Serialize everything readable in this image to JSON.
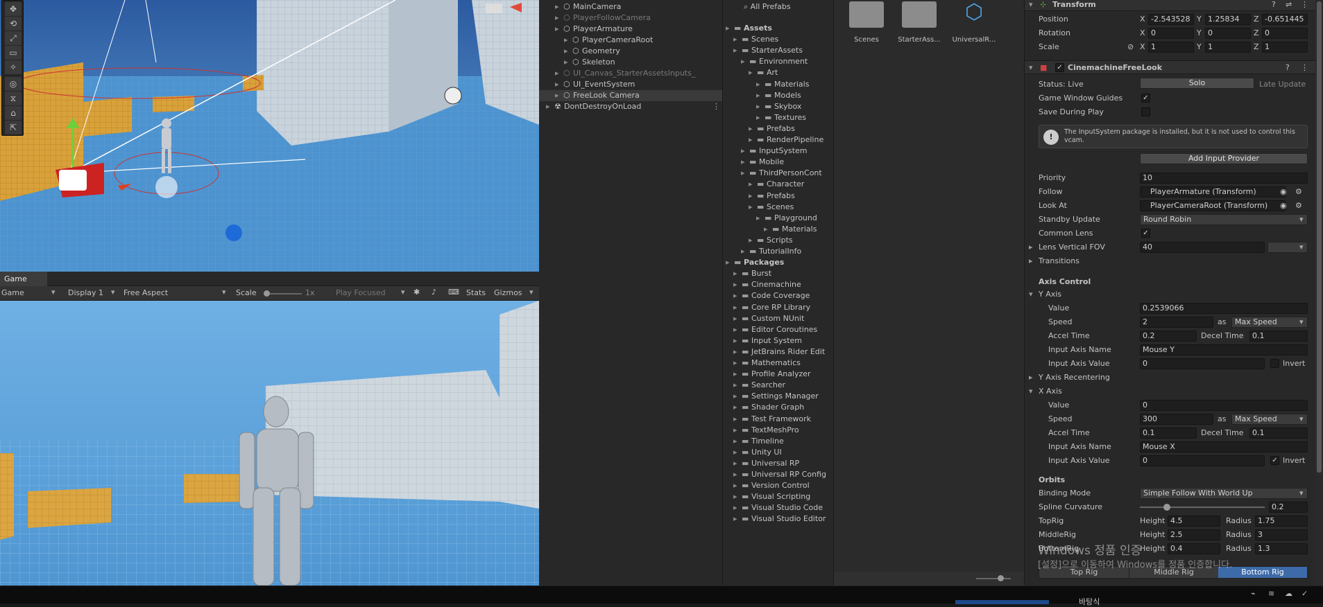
{
  "scene": {
    "tools": [
      "✥",
      "⟲",
      "⤢",
      "▭",
      "✧",
      "◎",
      "⧖",
      "⌂",
      "⇱"
    ]
  },
  "game": {
    "tab_label": "Game",
    "mode": "Game",
    "display": "Display 1",
    "aspect": "Free Aspect",
    "scale_label": "Scale",
    "scale_value": "1x",
    "play_focused": "Play Focused",
    "stats": "Stats",
    "gizmos": "Gizmos"
  },
  "hierarchy": {
    "rows": [
      {
        "label": "MainCamera",
        "indent": 1,
        "dim": false
      },
      {
        "label": "PlayerFollowCamera",
        "indent": 1,
        "dim": true
      },
      {
        "label": "PlayerArmature",
        "indent": 1,
        "dim": false
      },
      {
        "label": "PlayerCameraRoot",
        "indent": 2,
        "dim": false
      },
      {
        "label": "Geometry",
        "indent": 2,
        "dim": false
      },
      {
        "label": "Skeleton",
        "indent": 2,
        "dim": false
      },
      {
        "label": "UI_Canvas_StarterAssetsInputs_",
        "indent": 1,
        "dim": true
      },
      {
        "label": "UI_EventSystem",
        "indent": 1,
        "dim": false
      },
      {
        "label": "FreeLook Camera",
        "indent": 1,
        "dim": false,
        "selected": true
      },
      {
        "label": "DontDestroyOnLoad",
        "indent": 0,
        "dim": false
      }
    ]
  },
  "project": {
    "all_prefabs": "All Prefabs",
    "tree": [
      {
        "label": "Assets",
        "indent": 0,
        "bold": true
      },
      {
        "label": "Scenes",
        "indent": 1
      },
      {
        "label": "StarterAssets",
        "indent": 1
      },
      {
        "label": "Environment",
        "indent": 2
      },
      {
        "label": "Art",
        "indent": 3
      },
      {
        "label": "Materials",
        "indent": 4
      },
      {
        "label": "Models",
        "indent": 4
      },
      {
        "label": "Skybox",
        "indent": 4
      },
      {
        "label": "Textures",
        "indent": 4
      },
      {
        "label": "Prefabs",
        "indent": 3
      },
      {
        "label": "RenderPipeline",
        "indent": 3
      },
      {
        "label": "InputSystem",
        "indent": 2
      },
      {
        "label": "Mobile",
        "indent": 2
      },
      {
        "label": "ThirdPersonCont",
        "indent": 2
      },
      {
        "label": "Character",
        "indent": 3
      },
      {
        "label": "Prefabs",
        "indent": 3
      },
      {
        "label": "Scenes",
        "indent": 3
      },
      {
        "label": "Playground",
        "indent": 4
      },
      {
        "label": "Materials",
        "indent": 5
      },
      {
        "label": "Scripts",
        "indent": 3
      },
      {
        "label": "TutorialInfo",
        "indent": 2
      },
      {
        "label": "Packages",
        "indent": 0,
        "bold": true
      },
      {
        "label": "Burst",
        "indent": 1
      },
      {
        "label": "Cinemachine",
        "indent": 1
      },
      {
        "label": "Code Coverage",
        "indent": 1
      },
      {
        "label": "Core RP Library",
        "indent": 1
      },
      {
        "label": "Custom NUnit",
        "indent": 1
      },
      {
        "label": "Editor Coroutines",
        "indent": 1
      },
      {
        "label": "Input System",
        "indent": 1
      },
      {
        "label": "JetBrains Rider Edit",
        "indent": 1
      },
      {
        "label": "Mathematics",
        "indent": 1
      },
      {
        "label": "Profile Analyzer",
        "indent": 1
      },
      {
        "label": "Searcher",
        "indent": 1
      },
      {
        "label": "Settings Manager",
        "indent": 1
      },
      {
        "label": "Shader Graph",
        "indent": 1
      },
      {
        "label": "Test Framework",
        "indent": 1
      },
      {
        "label": "TextMeshPro",
        "indent": 1
      },
      {
        "label": "Timeline",
        "indent": 1
      },
      {
        "label": "Unity UI",
        "indent": 1
      },
      {
        "label": "Universal RP",
        "indent": 1
      },
      {
        "label": "Universal RP Config",
        "indent": 1
      },
      {
        "label": "Version Control",
        "indent": 1
      },
      {
        "label": "Visual Scripting",
        "indent": 1
      },
      {
        "label": "Visual Studio Code",
        "indent": 1
      },
      {
        "label": "Visual Studio Editor",
        "indent": 1
      }
    ],
    "assets": [
      "Scenes",
      "StarterAss...",
      "UniversalR..."
    ]
  },
  "inspector": {
    "transform": {
      "title": "Transform",
      "position": {
        "label": "Position",
        "x": "-2.543528",
        "y": "1.25834",
        "z": "-0.651445"
      },
      "rotation": {
        "label": "Rotation",
        "x": "0",
        "y": "0",
        "z": "0"
      },
      "scale": {
        "label": "Scale",
        "x": "1",
        "y": "1",
        "z": "1"
      }
    },
    "freelook": {
      "title": "CinemachineFreeLook",
      "status_label": "Status: Live",
      "solo": "Solo",
      "late_update": "Late Update",
      "game_window_guides": "Game Window Guides",
      "save_during_play": "Save During Play",
      "warning": "The InputSystem package is installed, but it is not used to control this vcam.",
      "add_input_provider": "Add Input Provider",
      "priority": {
        "label": "Priority",
        "value": "10"
      },
      "follow": {
        "label": "Follow",
        "value": "PlayerArmature (Transform)"
      },
      "look_at": {
        "label": "Look At",
        "value": "PlayerCameraRoot (Transform)"
      },
      "standby": {
        "label": "Standby Update",
        "value": "Round Robin"
      },
      "common_lens": "Common Lens",
      "lens_fov": {
        "label": "Lens Vertical FOV",
        "value": "40"
      },
      "transitions": "Transitions",
      "axis_control": "Axis Control",
      "y_axis": {
        "title": "Y Axis",
        "value": "0.2539066",
        "speed": "2",
        "speed_mode": "Max Speed",
        "accel": "0.2",
        "decel": "0.1",
        "axis_name": "Mouse Y",
        "axis_value": "0",
        "invert": false
      },
      "y_recentering": "Y Axis Recentering",
      "x_axis": {
        "title": "X Axis",
        "value": "0",
        "speed": "300",
        "speed_mode": "Max Speed",
        "accel": "0.1",
        "decel": "0.1",
        "axis_name": "Mouse X",
        "axis_value": "0",
        "invert": true
      },
      "labels": {
        "value": "Value",
        "speed": "Speed",
        "as": "as",
        "accel": "Accel Time",
        "decel": "Decel Time",
        "axis_name": "Input Axis Name",
        "axis_value": "Input Axis Value",
        "invert": "Invert"
      },
      "orbits": "Orbits",
      "binding": {
        "label": "Binding Mode",
        "value": "Simple Follow With World Up"
      },
      "spline": {
        "label": "Spline Curvature",
        "value": "0.2"
      },
      "top_rig": {
        "label": "TopRig",
        "height": "4.5",
        "radius": "1.75"
      },
      "middle_rig": {
        "label": "MiddleRig",
        "height": "2.5",
        "radius": "3"
      },
      "bottom_rig": {
        "label": "BottomRig",
        "height": "0.4",
        "radius": "1.3"
      },
      "height_label": "Height",
      "radius_label": "Radius",
      "rig_tabs": [
        "Top Rig",
        "Middle Rig",
        "Bottom Rig"
      ]
    }
  },
  "watermark": {
    "line1": "Windows 정품 인증",
    "line2": "[설정]으로 이동하여 Windows를 정품 인증합니다."
  },
  "taskbar": {
    "label": "바탕식"
  }
}
